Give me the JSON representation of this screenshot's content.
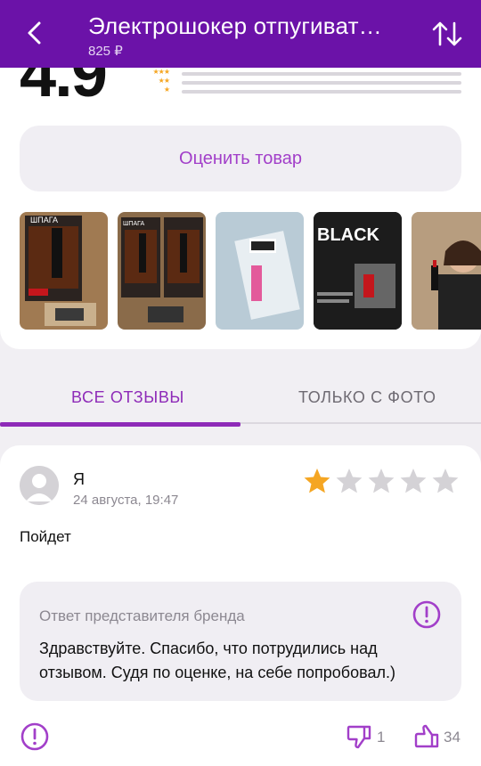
{
  "header": {
    "title": "Электрошокер отпугиват…",
    "price": "825 ₽"
  },
  "rating": {
    "value": "4.9",
    "distribution": [
      {
        "stars": 3,
        "fraction": 0.0
      },
      {
        "stars": 2,
        "fraction": 0.0
      },
      {
        "stars": 1,
        "fraction": 0.0
      }
    ]
  },
  "rate_button": {
    "label": "Оценить товар"
  },
  "photos": [
    {
      "label": "ШПАГА"
    },
    {
      "label": "ШПАГА"
    },
    {
      "label": ""
    },
    {
      "label": "BLACK"
    },
    {
      "label": ""
    }
  ],
  "tabs": [
    {
      "label": "ВСЕ ОТЗЫВЫ",
      "active": true
    },
    {
      "label": "ТОЛЬКО С ФОТО",
      "active": false
    }
  ],
  "review": {
    "author": "Я",
    "date": "24 августа, 19:47",
    "rating": 1,
    "max_rating": 5,
    "text": "Пойдет",
    "reply": {
      "title": "Ответ представителя бренда",
      "text": "Здравствуйте. Спасибо, что потрудились над отзывом. Судя по оценке, на себе попробовал.)"
    },
    "dislikes": "1",
    "likes": "34"
  },
  "colors": {
    "header": "#6b12a8",
    "accent": "#8e2bb8",
    "star": "#f5a623",
    "star_empty": "#d4d2d6"
  },
  "icons": {
    "back": "back-arrow-icon",
    "sort": "sort-icon",
    "report": "alert-circle-icon",
    "dislike": "thumbs-down-icon",
    "like": "thumbs-up-icon"
  }
}
